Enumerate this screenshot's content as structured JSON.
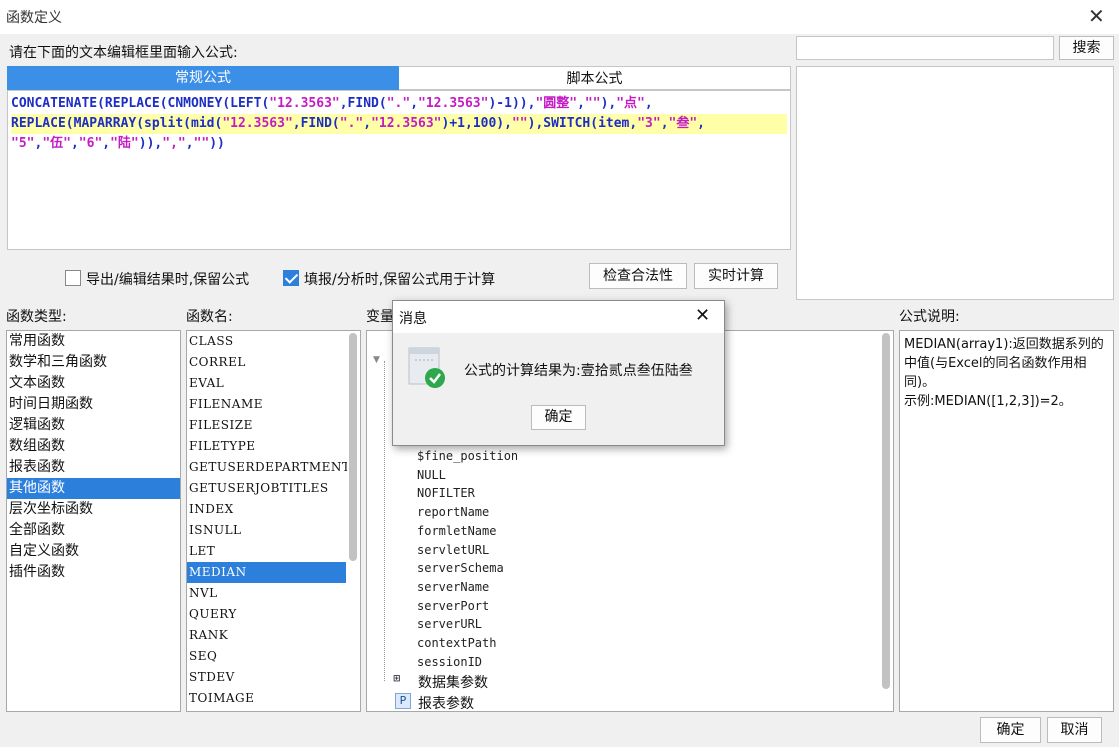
{
  "window": {
    "title": "函数定义"
  },
  "editor": {
    "prompt": "请在下面的文本编辑框里面输入公式:",
    "tabs": [
      "常规公式",
      "脚本公式"
    ],
    "formula_lines": [
      "CONCATENATE(REPLACE(CNMONEY(LEFT(\"12.3563\",FIND(\".\",\"12.3563\")-1)),\"圆整\",\"\"),\"点\",",
      "REPLACE(MAPARRAY(split(mid(\"12.3563\",FIND(\".\",\"12.3563\")+1,100),\"\"),SWITCH(item,\"3\",\"叁\",",
      "\"5\",\"伍\",\"6\",\"陆\")),\",\",\"\"))"
    ]
  },
  "search": {
    "value": "",
    "button": "搜索"
  },
  "options": {
    "keep_formula_export": {
      "label": "导出/编辑结果时,保留公式",
      "checked": false
    },
    "keep_formula_fill": {
      "label": "填报/分析时,保留公式用于计算",
      "checked": true
    },
    "check_button": "检查合法性",
    "realtime_button": "实时计算"
  },
  "function_types": {
    "header": "函数类型:",
    "items": [
      "常用函数",
      "数学和三角函数",
      "文本函数",
      "时间日期函数",
      "逻辑函数",
      "数组函数",
      "报表函数",
      "其他函数",
      "层次坐标函数",
      "全部函数",
      "自定义函数",
      "插件函数"
    ],
    "selected": "其他函数"
  },
  "function_names": {
    "header": "函数名:",
    "items": [
      "CLASS",
      "CORREL",
      "EVAL",
      "FILENAME",
      "FILESIZE",
      "FILETYPE",
      "GETUSERDEPARTMENTS",
      "GETUSERJOBTITLES",
      "INDEX",
      "ISNULL",
      "LET",
      "MEDIAN",
      "NVL",
      "QUERY",
      "RANK",
      "SEQ",
      "STDEV",
      "TOIMAGE"
    ],
    "selected": "MEDIAN"
  },
  "variables": {
    "header": "变量",
    "items": [
      "$fine_position",
      "NULL",
      "NOFILTER",
      "reportName",
      "formletName",
      "servletURL",
      "serverSchema",
      "serverName",
      "serverPort",
      "serverURL",
      "contextPath",
      "sessionID"
    ],
    "groups": [
      "数据集参数",
      "报表参数"
    ]
  },
  "description": {
    "header": "公式说明:",
    "text_1": "MEDIAN(array1):返回数据系列的中值(与Excel的同名函数作用相同)。",
    "text_2": "示例:MEDIAN([1,2,3])=2。"
  },
  "footer": {
    "ok": "确定",
    "cancel": "取消"
  },
  "message_dialog": {
    "title": "消息",
    "message": "公式的计算结果为:壹拾贰点叁伍陆叁",
    "ok": "确定"
  },
  "colors": {
    "accent": "#3c8fe6",
    "selection": "#2d7fdc",
    "function": "#1d2ec4",
    "string": "#c41bc4",
    "highlight": "#ffffa8",
    "success": "#2ea84a"
  }
}
